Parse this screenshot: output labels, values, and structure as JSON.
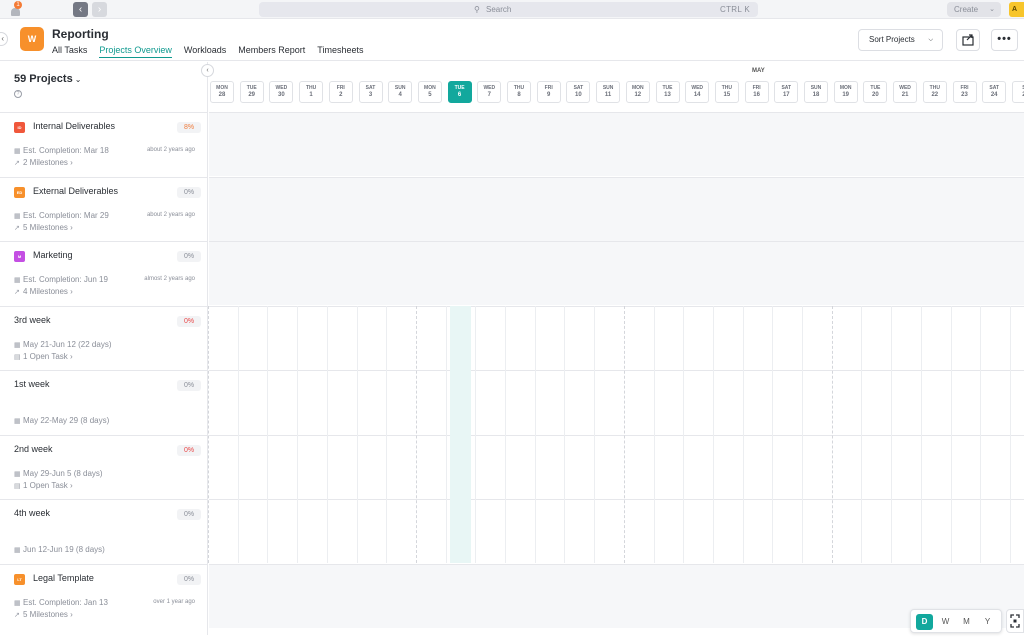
{
  "topbar": {
    "notification_count": "1",
    "search_placeholder": "Search",
    "search_shortcut": "CTRL K",
    "create_label": "Create",
    "avatar_initial": "A"
  },
  "header": {
    "space_initial": "W",
    "title": "Reporting",
    "tabs": [
      "All Tasks",
      "Projects Overview",
      "Workloads",
      "Members Report",
      "Timesheets"
    ],
    "active_tab": "Projects Overview",
    "sort_label": "Sort Projects"
  },
  "sidebar": {
    "project_count": "59 Projects",
    "rows": [
      {
        "badge": "ID",
        "badge_color": "#f0573b",
        "name": "Internal Deliverables",
        "pct": "8%",
        "pct_style": "warn",
        "line1": "Est. Completion: Mar 18",
        "line2": "2 Milestones",
        "ago": "about 2 years ago"
      },
      {
        "badge": "ED",
        "badge_color": "#f7902b",
        "name": "External Deliverables",
        "pct": "0%",
        "pct_style": "",
        "line1": "Est. Completion: Mar 29",
        "line2": "5 Milestones",
        "ago": "about 2 years ago"
      },
      {
        "badge": "M",
        "badge_color": "#c44fe3",
        "name": "Marketing",
        "pct": "0%",
        "pct_style": "",
        "line1": "Est. Completion: Jun 19",
        "line2": "4 Milestones",
        "ago": "almost 2 years ago"
      },
      {
        "badge": "",
        "badge_color": "",
        "name": "3rd week",
        "pct": "0%",
        "pct_style": "red",
        "line1": "May 21-Jun 12 (22 days)",
        "line2": "1 Open Task",
        "ago": ""
      },
      {
        "badge": "",
        "badge_color": "",
        "name": "1st week",
        "pct": "0%",
        "pct_style": "",
        "line1": "",
        "line2": "May 22-May 29 (8 days)",
        "ago": ""
      },
      {
        "badge": "",
        "badge_color": "",
        "name": "2nd week",
        "pct": "0%",
        "pct_style": "red",
        "line1": "May 29-Jun 5 (8 days)",
        "line2": "1 Open Task",
        "ago": ""
      },
      {
        "badge": "",
        "badge_color": "",
        "name": "4th week",
        "pct": "0%",
        "pct_style": "",
        "line1": "",
        "line2": "Jun 12-Jun 19 (8 days)",
        "ago": ""
      },
      {
        "badge": "LT",
        "badge_color": "#f7902b",
        "name": "Legal Template",
        "pct": "0%",
        "pct_style": "",
        "line1": "Est. Completion: Jan 13",
        "line2": "5 Milestones",
        "ago": "over 1 year ago"
      }
    ]
  },
  "timeline": {
    "month": "MAY",
    "today_index": 8,
    "days": [
      {
        "dw": "MON",
        "dn": "28"
      },
      {
        "dw": "TUE",
        "dn": "29"
      },
      {
        "dw": "WED",
        "dn": "30"
      },
      {
        "dw": "THU",
        "dn": "1"
      },
      {
        "dw": "FRI",
        "dn": "2"
      },
      {
        "dw": "SAT",
        "dn": "3"
      },
      {
        "dw": "SUN",
        "dn": "4"
      },
      {
        "dw": "MON",
        "dn": "5"
      },
      {
        "dw": "TUE",
        "dn": "6"
      },
      {
        "dw": "WED",
        "dn": "7"
      },
      {
        "dw": "THU",
        "dn": "8"
      },
      {
        "dw": "FRI",
        "dn": "9"
      },
      {
        "dw": "SAT",
        "dn": "10"
      },
      {
        "dw": "SUN",
        "dn": "11"
      },
      {
        "dw": "MON",
        "dn": "12"
      },
      {
        "dw": "TUE",
        "dn": "13"
      },
      {
        "dw": "WED",
        "dn": "14"
      },
      {
        "dw": "THU",
        "dn": "15"
      },
      {
        "dw": "FRI",
        "dn": "16"
      },
      {
        "dw": "SAT",
        "dn": "17"
      },
      {
        "dw": "SUN",
        "dn": "18"
      },
      {
        "dw": "MON",
        "dn": "19"
      },
      {
        "dw": "TUE",
        "dn": "20"
      },
      {
        "dw": "WED",
        "dn": "21"
      },
      {
        "dw": "THU",
        "dn": "22"
      },
      {
        "dw": "FRI",
        "dn": "23"
      },
      {
        "dw": "SAT",
        "dn": "24"
      },
      {
        "dw": "S",
        "dn": "2"
      }
    ]
  },
  "view_toggle": {
    "options": [
      "D",
      "W",
      "M",
      "Y"
    ],
    "active": "D"
  }
}
